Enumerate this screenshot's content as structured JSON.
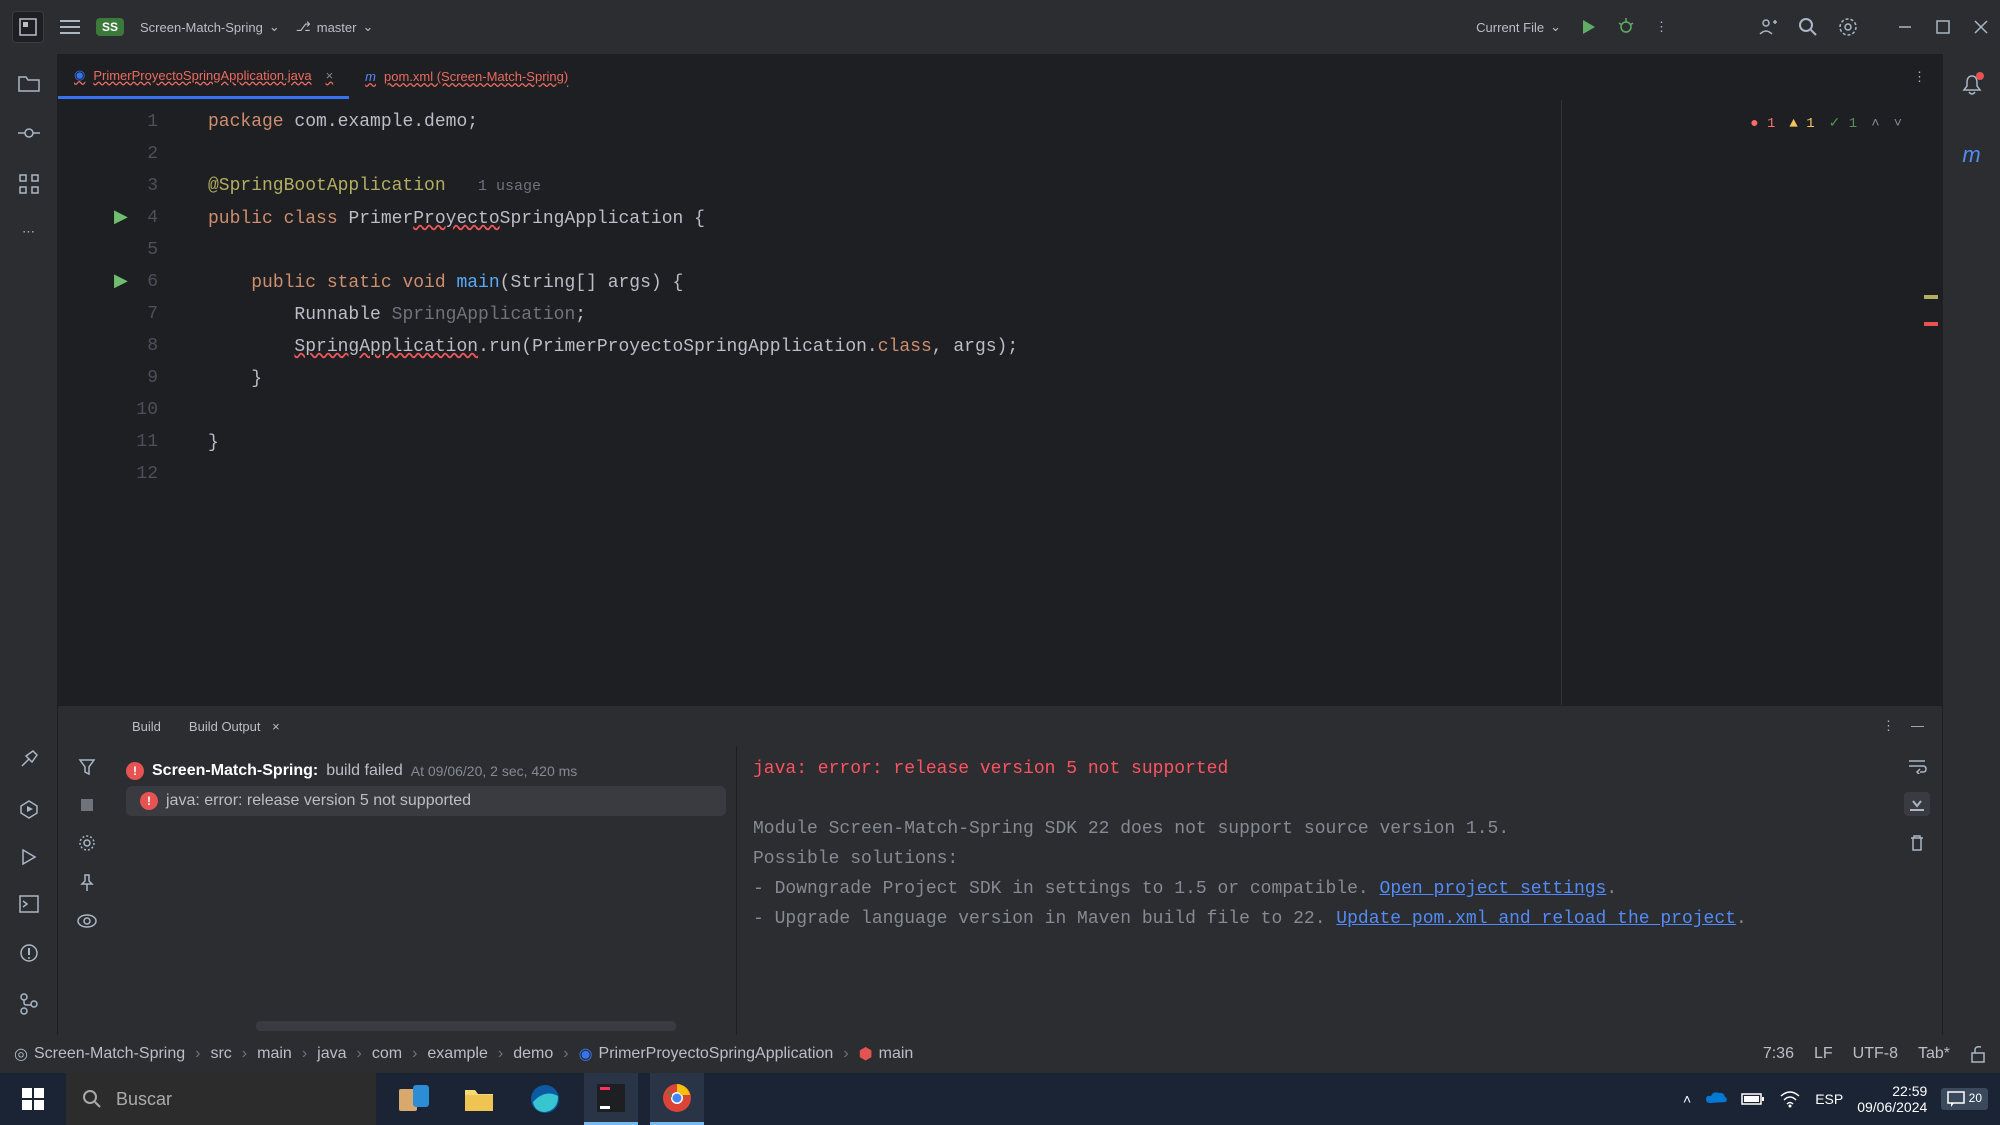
{
  "titlebar": {
    "project_badge": "SS",
    "project_name": "Screen-Match-Spring",
    "branch": "master",
    "run_config": "Current File"
  },
  "tabs": [
    {
      "label": "PrimerProyectoSpringApplication.java",
      "active": true
    },
    {
      "label": "pom.xml (Screen-Match-Spring)",
      "active": false
    }
  ],
  "editor": {
    "badges": {
      "errors": "1",
      "warnings": "1",
      "ok": "1"
    },
    "lines": [
      "1",
      "2",
      "3",
      "4",
      "5",
      "6",
      "7",
      "8",
      "9",
      "10",
      "11",
      "12"
    ],
    "code": {
      "l1_package": "package ",
      "l1_pkg": "com.example.demo",
      "l3_ann": "@SpringBootApplication",
      "l3_usage": "1 usage",
      "l4_kw1": "public class ",
      "l4_cls": "Primer",
      "l4_cls_w": "Proyecto",
      "l4_cls2": "SpringApplication {",
      "l6_kw": "public static void ",
      "l6_main": "main",
      "l6_sig": "(String[] args) {",
      "l7_runnable": "Runnable ",
      "l7_sa": "SpringApplication",
      "l8_sa": "SpringApplication",
      "l8_run": ".run(PrimerProyectoSpringApplication.",
      "l8_class": "class",
      "l8_rest": ", args);",
      "l9": "}",
      "l11": "}"
    }
  },
  "build_panel": {
    "tab1": "Build",
    "tab2": "Build Output",
    "tree": {
      "root_name": "Screen-Match-Spring:",
      "root_status": "build failed",
      "root_time": "At 09/06/20, 2 sec, 420 ms",
      "child": "java: error: release version 5 not supported"
    },
    "output": {
      "line1": "java: error: release version 5 not supported",
      "line3": "Module Screen-Match-Spring SDK 22 does not support source version 1.5.",
      "line4": "Possible solutions:",
      "line5a": "- Downgrade Project SDK in settings to 1.5 or compatible. ",
      "line5link": "Open project settings",
      "line6a": "- Upgrade language version in Maven build file to 22. ",
      "line6link": "Update pom.xml and reload the project"
    }
  },
  "breadcrumb": {
    "parts": [
      "Screen-Match-Spring",
      "src",
      "main",
      "java",
      "com",
      "example",
      "demo",
      "PrimerProyectoSpringApplication",
      "main"
    ],
    "status": {
      "pos": "7:36",
      "eol": "LF",
      "enc": "UTF-8",
      "indent": "Tab*"
    }
  },
  "taskbar": {
    "search_placeholder": "Buscar",
    "lang": "ESP",
    "time": "22:59",
    "date": "09/06/2024",
    "notif": "20"
  }
}
